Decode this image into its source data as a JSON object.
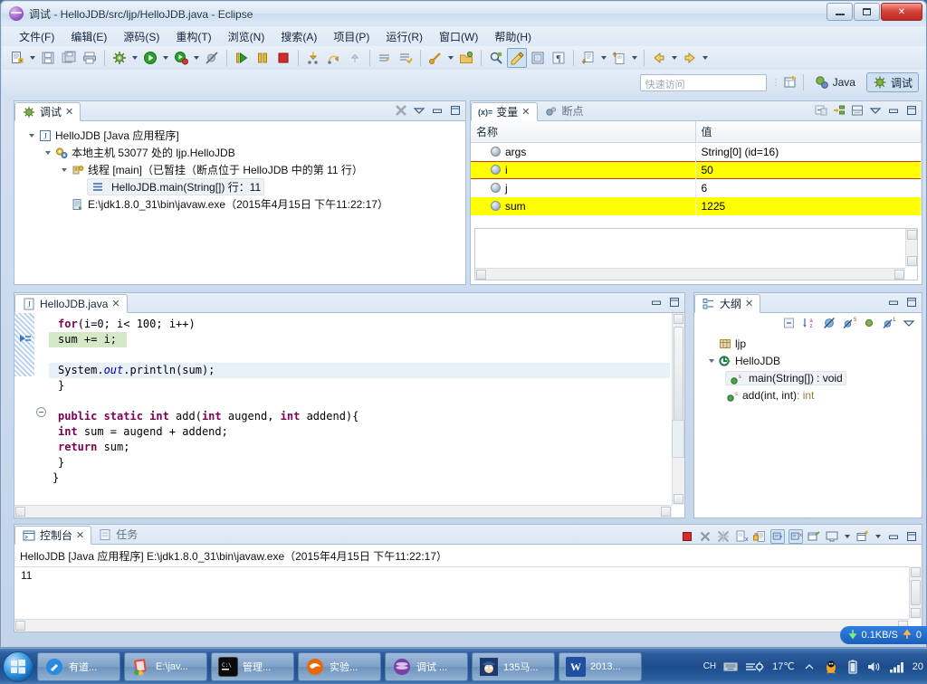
{
  "window": {
    "title": "调试 - HelloJDB/src/ljp/HelloJDB.java - Eclipse",
    "icon": "eclipse-debug-icon",
    "minimize": "最小化",
    "maximize": "最大化",
    "close": "关闭"
  },
  "menubar": {
    "items": [
      {
        "label": "文件(F)",
        "name": "menu-file"
      },
      {
        "label": "编辑(E)",
        "name": "menu-edit"
      },
      {
        "label": "源码(S)",
        "name": "menu-source"
      },
      {
        "label": "重构(T)",
        "name": "menu-refactor"
      },
      {
        "label": "浏览(N)",
        "name": "menu-navigate"
      },
      {
        "label": "搜索(A)",
        "name": "menu-search"
      },
      {
        "label": "项目(P)",
        "name": "menu-project"
      },
      {
        "label": "运行(R)",
        "name": "menu-run"
      },
      {
        "label": "窗口(W)",
        "name": "menu-window"
      },
      {
        "label": "帮助(H)",
        "name": "menu-help"
      }
    ]
  },
  "toolbar": {
    "buttons": [
      {
        "name": "new-wizard-button",
        "icon": "new-file-icon",
        "dropdown": true
      },
      {
        "name": "save-button",
        "icon": "save-icon",
        "dropdown": false
      },
      {
        "name": "save-all-button",
        "icon": "save-all-icon",
        "dropdown": false
      },
      {
        "name": "print-button",
        "icon": "print-icon",
        "dropdown": false
      },
      {
        "name": "debug-button",
        "icon": "debug-bug-icon",
        "dropdown": true
      },
      {
        "name": "run-button",
        "icon": "run-play-icon",
        "dropdown": true
      },
      {
        "name": "coverage-button",
        "icon": "coverage-icon",
        "dropdown": true
      },
      {
        "name": "skip-breakpoints-button",
        "icon": "skip-breakpoints-icon",
        "dropdown": false
      },
      {
        "name": "resume-button",
        "icon": "resume-icon",
        "dropdown": false
      },
      {
        "name": "suspend-button",
        "icon": "suspend-pause-icon",
        "dropdown": false
      },
      {
        "name": "terminate-button",
        "icon": "terminate-stop-icon",
        "dropdown": false
      },
      {
        "name": "step-into-button",
        "icon": "step-into-icon",
        "dropdown": false
      },
      {
        "name": "step-over-button",
        "icon": "step-over-icon",
        "dropdown": false
      },
      {
        "name": "step-return-button",
        "icon": "step-return-icon",
        "dropdown": false
      },
      {
        "name": "new-java-project-button",
        "icon": "java-project-icon",
        "dropdown": false
      },
      {
        "name": "new-class-button",
        "icon": "new-class-icon",
        "dropdown": false
      },
      {
        "name": "external-tools-button",
        "icon": "external-tools-icon",
        "dropdown": true
      },
      {
        "name": "open-type-button",
        "icon": "open-type-icon",
        "dropdown": false
      },
      {
        "name": "search-button",
        "icon": "search-icon",
        "dropdown": false
      },
      {
        "name": "toggle-mark-occurrences-button",
        "icon": "mark-occurrences-icon",
        "dropdown": false
      },
      {
        "name": "toggle-block-selection-button",
        "icon": "block-selection-icon",
        "dropdown": false
      },
      {
        "name": "show-whitespace-button",
        "icon": "pilcrow-icon",
        "dropdown": false
      },
      {
        "name": "next-annotation-button",
        "icon": "next-annotation-icon",
        "dropdown": true
      },
      {
        "name": "previous-annotation-button",
        "icon": "previous-annotation-icon",
        "dropdown": true
      },
      {
        "name": "back-button",
        "icon": "back-arrow-icon",
        "dropdown": true
      },
      {
        "name": "forward-button",
        "icon": "forward-arrow-icon",
        "dropdown": true
      }
    ]
  },
  "perspective_bar": {
    "quick_access_placeholder": "快速访问",
    "open_perspective_tooltip": "打开透视图",
    "perspectives": [
      {
        "label": "Java",
        "name": "perspective-java",
        "active": false
      },
      {
        "label": "调试",
        "name": "perspective-debug",
        "active": true
      }
    ]
  },
  "debug_view": {
    "tab_label": "调试",
    "tab_icon": "debug-bug-icon",
    "close_glyph": "✕",
    "tools": [
      {
        "name": "disconnect-icon"
      },
      {
        "name": "view-menu-icon"
      },
      {
        "name": "minimize-icon"
      },
      {
        "name": "maximize-icon"
      }
    ],
    "tree": [
      {
        "level": 0,
        "expanded": true,
        "icon": "launch-config-icon",
        "label": "HelloJDB [Java 应用程序]",
        "name": "debug-launch-node"
      },
      {
        "level": 1,
        "expanded": true,
        "icon": "vm-icon",
        "label": "本地主机 53077 处的 ljp.HelloJDB",
        "name": "debug-vm-node"
      },
      {
        "level": 2,
        "expanded": true,
        "icon": "thread-icon",
        "label": "线程 [main]（已暂挂（断点位于 HelloJDB 中的第 11 行）",
        "name": "debug-thread-node"
      },
      {
        "level": 3,
        "expanded": false,
        "icon": "stackframe-icon",
        "label": "HelloJDB.main(String[]) 行：11",
        "name": "debug-stackframe-node",
        "selected": true
      },
      {
        "level": 2,
        "expanded": false,
        "icon": "process-icon",
        "label": "E:\\jdk1.8.0_31\\bin\\javaw.exe（2015年4月15日 下午11:22:17）",
        "name": "debug-process-node"
      }
    ]
  },
  "variables_view": {
    "tabs": [
      {
        "label": "变量",
        "name": "tab-variables",
        "icon": "variables-icon",
        "active": true,
        "close_glyph": "✕"
      },
      {
        "label": "断点",
        "name": "tab-breakpoints",
        "icon": "breakpoint-icon",
        "active": false
      }
    ],
    "tools": [
      {
        "name": "collapse-all-icon"
      },
      {
        "name": "show-logical-structure-icon"
      },
      {
        "name": "show-detail-pane-icon"
      },
      {
        "name": "view-menu-icon"
      },
      {
        "name": "minimize-icon"
      },
      {
        "name": "maximize-icon"
      }
    ],
    "columns": [
      "名称",
      "值"
    ],
    "rows": [
      {
        "name": "args",
        "value": "String[0]  (id=16)",
        "highlight": false,
        "boxed": false
      },
      {
        "name": "i",
        "value": "50",
        "highlight": true,
        "boxed": true
      },
      {
        "name": "j",
        "value": "6",
        "highlight": false,
        "boxed": false
      },
      {
        "name": "sum",
        "value": "1225",
        "highlight": true,
        "boxed": false
      }
    ],
    "detail_text": ""
  },
  "editor": {
    "tab_label": "HelloJDB.java",
    "tab_icon": "java-file-icon",
    "close_glyph": "✕",
    "tools": [
      {
        "name": "minimize-icon"
      },
      {
        "name": "maximize-icon"
      }
    ],
    "lines": [
      {
        "segments": [
          {
            "t": "    ",
            "c": ""
          },
          {
            "t": "for",
            "c": "kw"
          },
          {
            "t": "(i=0; i< 100; i++)",
            "c": ""
          }
        ],
        "state": "normal"
      },
      {
        "segments": [
          {
            "t": "   sum += i;",
            "c": ""
          }
        ],
        "state": "current"
      },
      {
        "segments": [
          {
            "t": "",
            "c": ""
          }
        ],
        "state": "normal"
      },
      {
        "segments": [
          {
            "t": "   System.",
            "c": ""
          },
          {
            "t": "out",
            "c": "fld"
          },
          {
            "t": ".println(sum);",
            "c": ""
          }
        ],
        "state": "hl"
      },
      {
        "segments": [
          {
            "t": "   }",
            "c": ""
          }
        ],
        "state": "normal"
      },
      {
        "segments": [
          {
            "t": "",
            "c": ""
          }
        ],
        "state": "normal"
      },
      {
        "segments": [
          {
            "t": "   ",
            "c": ""
          },
          {
            "t": "public static int",
            "c": "kw"
          },
          {
            "t": " add(",
            "c": ""
          },
          {
            "t": "int",
            "c": "kw"
          },
          {
            "t": " augend, ",
            "c": ""
          },
          {
            "t": "int",
            "c": "kw"
          },
          {
            "t": " addend){",
            "c": ""
          }
        ],
        "state": "fold"
      },
      {
        "segments": [
          {
            "t": "   ",
            "c": ""
          },
          {
            "t": "int",
            "c": "kw"
          },
          {
            "t": " sum = augend + addend;",
            "c": ""
          }
        ],
        "state": "normal"
      },
      {
        "segments": [
          {
            "t": "   ",
            "c": ""
          },
          {
            "t": "return",
            "c": "kw"
          },
          {
            "t": " sum;",
            "c": ""
          }
        ],
        "state": "normal"
      },
      {
        "segments": [
          {
            "t": "   }",
            "c": ""
          }
        ],
        "state": "normal"
      },
      {
        "segments": [
          {
            "t": " }",
            "c": ""
          }
        ],
        "state": "normal"
      }
    ]
  },
  "outline_view": {
    "tab_label": "大纲",
    "tab_icon": "outline-icon",
    "close_glyph": "✕",
    "tools": [
      {
        "name": "minimize-icon"
      },
      {
        "name": "maximize-icon"
      }
    ],
    "local_tools": [
      {
        "name": "collapse-all-icon"
      },
      {
        "name": "sort-icon"
      },
      {
        "name": "hide-fields-icon"
      },
      {
        "name": "hide-static-icon"
      },
      {
        "name": "hide-nonpublic-icon"
      },
      {
        "name": "hide-local-types-icon"
      },
      {
        "name": "view-menu-icon"
      }
    ],
    "tree": [
      {
        "level": 0,
        "expanded": null,
        "icon": "package-icon",
        "label": "ljp",
        "suffix": "",
        "name": "outline-package-ljp"
      },
      {
        "level": 0,
        "expanded": true,
        "icon": "class-icon",
        "label": "HelloJDB",
        "suffix": "",
        "name": "outline-class-hellojdb"
      },
      {
        "level": 1,
        "expanded": null,
        "icon": "method-public-static-icon",
        "label": "main(String[])",
        "suffix": " : void",
        "name": "outline-method-main",
        "selected": true
      },
      {
        "level": 1,
        "expanded": null,
        "icon": "method-public-static-icon",
        "label": "add(int, int)",
        "suffix": " : int",
        "name": "outline-method-add"
      }
    ]
  },
  "console_view": {
    "tabs": [
      {
        "label": "控制台",
        "name": "tab-console",
        "icon": "console-icon",
        "active": true,
        "close_glyph": "✕"
      },
      {
        "label": "任务",
        "name": "tab-tasks",
        "icon": "tasks-icon",
        "active": false
      }
    ],
    "tools": [
      {
        "name": "terminate-stop-icon"
      },
      {
        "name": "remove-launch-icon"
      },
      {
        "name": "remove-all-terminated-icon"
      },
      {
        "name": "clear-console-icon"
      },
      {
        "name": "scroll-lock-icon"
      },
      {
        "name": "pin-console-icon",
        "boxed": true
      },
      {
        "name": "display-selected-console-icon",
        "boxed": true
      },
      {
        "name": "open-console-icon"
      },
      {
        "name": "display-console-icon",
        "dropdown": true
      },
      {
        "name": "new-console-view-icon",
        "dropdown": true
      },
      {
        "name": "minimize-icon"
      },
      {
        "name": "maximize-icon"
      }
    ],
    "header": "HelloJDB [Java 应用程序] E:\\jdk1.8.0_31\\bin\\javaw.exe（2015年4月15日 下午11:22:17）",
    "output": [
      "11"
    ]
  },
  "net_widget": {
    "down_label": "0.1KB/S",
    "up_label": "0",
    "down_icon": "arrow-down-icon",
    "up_icon": "arrow-up-icon"
  },
  "taskbar": {
    "start_label": "开始",
    "items": [
      {
        "label": "有道...",
        "name": "taskbar-item-youdao",
        "icon": "youdao-icon",
        "color": "#2a8ae0"
      },
      {
        "label": "E:\\jav...",
        "name": "taskbar-item-explorer",
        "icon": "folder-notepad-icon",
        "color": "#d94a3d"
      },
      {
        "label": "管理...",
        "name": "taskbar-item-cmd",
        "icon": "cmd-icon",
        "color": "#111111"
      },
      {
        "label": "实验...",
        "name": "taskbar-item-firefox",
        "icon": "firefox-icon",
        "color": "#e8690b"
      },
      {
        "label": "调试 ...",
        "name": "taskbar-item-eclipse",
        "icon": "eclipse-icon",
        "color": "#7a3fa8"
      },
      {
        "label": "135马...",
        "name": "taskbar-item-media",
        "icon": "conan-icon",
        "color": "#1b3a6b"
      },
      {
        "label": "2013...",
        "name": "taskbar-item-wps",
        "icon": "wps-writer-icon",
        "color": "#1f4fa0"
      }
    ],
    "tray": {
      "ime_label": "CH",
      "ime_icon": "keyboard-icon",
      "weather_icon": "windy-sun-icon",
      "temperature": "17℃",
      "show_hidden_icon": "chevron-up-icon",
      "icons": [
        {
          "name": "qq-penguin-icon"
        },
        {
          "name": "battery-icon"
        },
        {
          "name": "volume-icon"
        },
        {
          "name": "network-signal-icon"
        }
      ],
      "clock": "20"
    }
  },
  "colors": {
    "accent": "#1d4c8c",
    "highlight_yellow": "#ffff00",
    "current_line_green": "#d6e9c6",
    "keyword_purple": "#7f0055",
    "field_blue": "#0000c0",
    "close_red": "#d9443a"
  }
}
